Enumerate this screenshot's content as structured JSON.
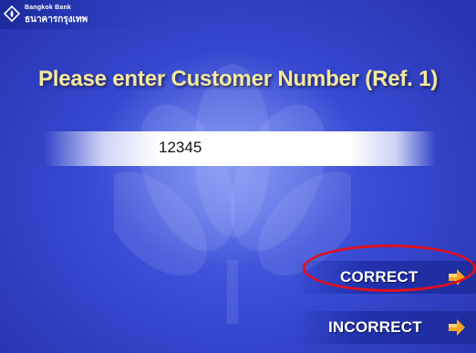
{
  "brand": {
    "name_en": "Bangkok Bank",
    "name_th": "ธนาคารกรุงเทพ",
    "logo_icon": "bangkok-bank-lotus-logo"
  },
  "prompt": {
    "title": "Please enter Customer Number (Ref. 1)"
  },
  "input": {
    "value": "12345"
  },
  "buttons": {
    "correct_label": "CORRECT",
    "incorrect_label": "INCORRECT",
    "arrow_icon": "orange-arrow-icon"
  },
  "colors": {
    "background": "#3548d0",
    "title_text": "#f2e9a0",
    "arrow_accent": "#f5a623",
    "highlight_circle": "#e0101c"
  }
}
